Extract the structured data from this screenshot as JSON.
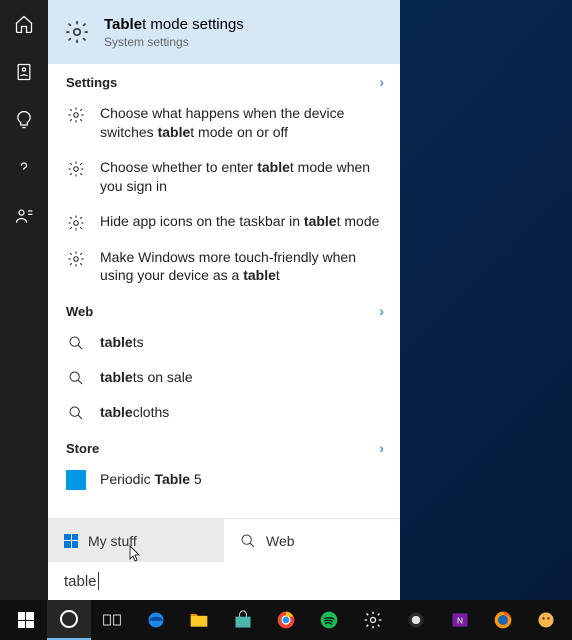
{
  "topResult": {
    "title_pre": "Table",
    "title_post": "t mode settings",
    "subtitle": "System settings"
  },
  "sections": {
    "settings": {
      "header": "Settings",
      "items": [
        {
          "pre": "Choose what happens when the device switches ",
          "bold": "table",
          "post": "t mode on or off"
        },
        {
          "pre": "Choose whether to enter ",
          "bold": "table",
          "post": "t mode when you sign in"
        },
        {
          "pre": "Hide app icons on the taskbar in ",
          "bold": "table",
          "post": "t mode"
        },
        {
          "pre": "Make Windows more touch-friendly when using your device as a ",
          "bold": "table",
          "post": "t"
        }
      ]
    },
    "web": {
      "header": "Web",
      "items": [
        {
          "pre": "",
          "bold": "table",
          "post": "ts"
        },
        {
          "pre": "",
          "bold": "table",
          "post": "ts on sale"
        },
        {
          "pre": "",
          "bold": "table",
          "post": "cloths"
        }
      ]
    },
    "store": {
      "header": "Store",
      "items": [
        {
          "pre": "Periodic ",
          "bold": "Table",
          "post": " 5"
        }
      ]
    }
  },
  "footer": {
    "mystuff": "My stuff",
    "web": "Web"
  },
  "search": {
    "query": "table"
  }
}
